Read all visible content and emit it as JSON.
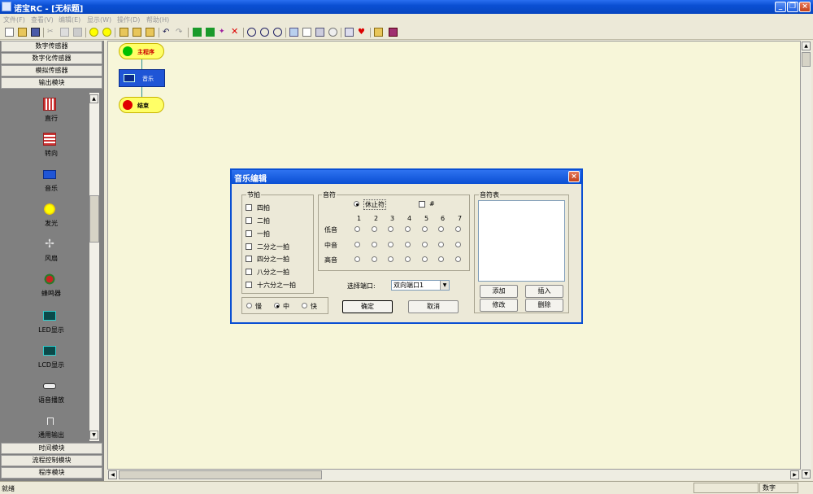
{
  "window": {
    "title": "诺宝RC - [无标题]"
  },
  "menu": [
    "文件(F)",
    "查看(V)",
    "编辑(E)",
    "显示(W)",
    "操作(D)",
    "帮助(H)"
  ],
  "categories_top": [
    "数字传感器",
    "数字化传感器",
    "模拟传感器",
    "输出模块"
  ],
  "palette_items": [
    "直行",
    "转向",
    "音乐",
    "发光",
    "风扇",
    "蜂鸣器",
    "LED显示",
    "LCD显示",
    "语音播放",
    "通用输出"
  ],
  "categories_bottom": [
    "时间模块",
    "流程控制模块",
    "程序模块"
  ],
  "flow": {
    "start": "主程序",
    "music": "音乐",
    "end": "结束"
  },
  "dialog": {
    "title": "音乐编辑",
    "beat_group": "节拍",
    "beats": [
      "四拍",
      "二拍",
      "一拍",
      "二分之一拍",
      "四分之一拍",
      "八分之一拍",
      "十六分之一拍"
    ],
    "note_group": "音符",
    "rest_label": "休止符",
    "sharp_label": "#",
    "note_numbers": [
      "1",
      "2",
      "3",
      "4",
      "5",
      "6",
      "7"
    ],
    "octaves": [
      "低音",
      "中音",
      "高音"
    ],
    "speeds": [
      "慢",
      "中",
      "快"
    ],
    "speed_selected": "中",
    "port_label": "选择端口:",
    "port_value": "双向端口1",
    "ok": "确定",
    "cancel": "取消",
    "table_group": "音符表",
    "add": "添加",
    "insert": "插入",
    "modify": "修改",
    "delete": "删除"
  },
  "status": {
    "left": "就绪",
    "mode": "数字"
  }
}
